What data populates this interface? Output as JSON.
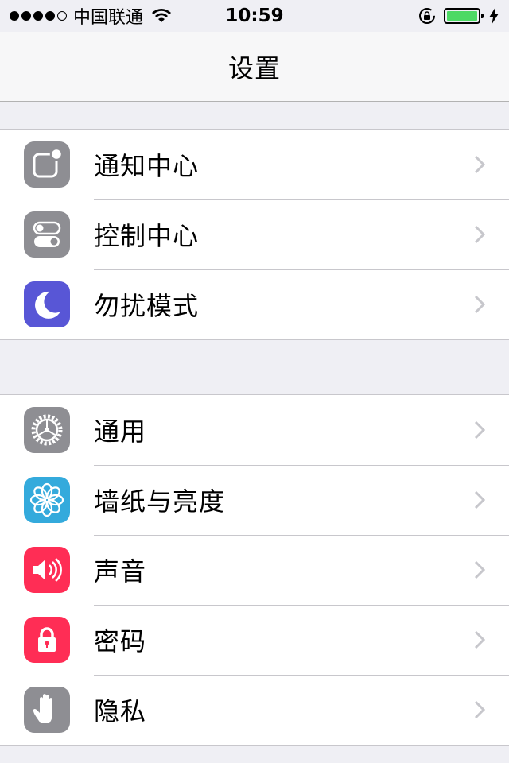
{
  "status_bar": {
    "carrier": "中国联通",
    "time": "10:59",
    "battery_color": "#4cd964"
  },
  "nav": {
    "title": "设置"
  },
  "groups": [
    {
      "items": [
        {
          "label": "通知中心",
          "icon": "notification-center-icon",
          "color": "#8e8e93"
        },
        {
          "label": "控制中心",
          "icon": "control-center-icon",
          "color": "#8e8e93"
        },
        {
          "label": "勿扰模式",
          "icon": "moon-icon",
          "color": "#5856d6"
        }
      ]
    },
    {
      "items": [
        {
          "label": "通用",
          "icon": "gear-icon",
          "color": "#8e8e93"
        },
        {
          "label": "墙纸与亮度",
          "icon": "flower-icon",
          "color": "#34aadc"
        },
        {
          "label": "声音",
          "icon": "speaker-icon",
          "color": "#ff2d55"
        },
        {
          "label": "密码",
          "icon": "lock-icon",
          "color": "#ff2d55"
        },
        {
          "label": "隐私",
          "icon": "hand-icon",
          "color": "#8e8e93"
        }
      ]
    }
  ]
}
